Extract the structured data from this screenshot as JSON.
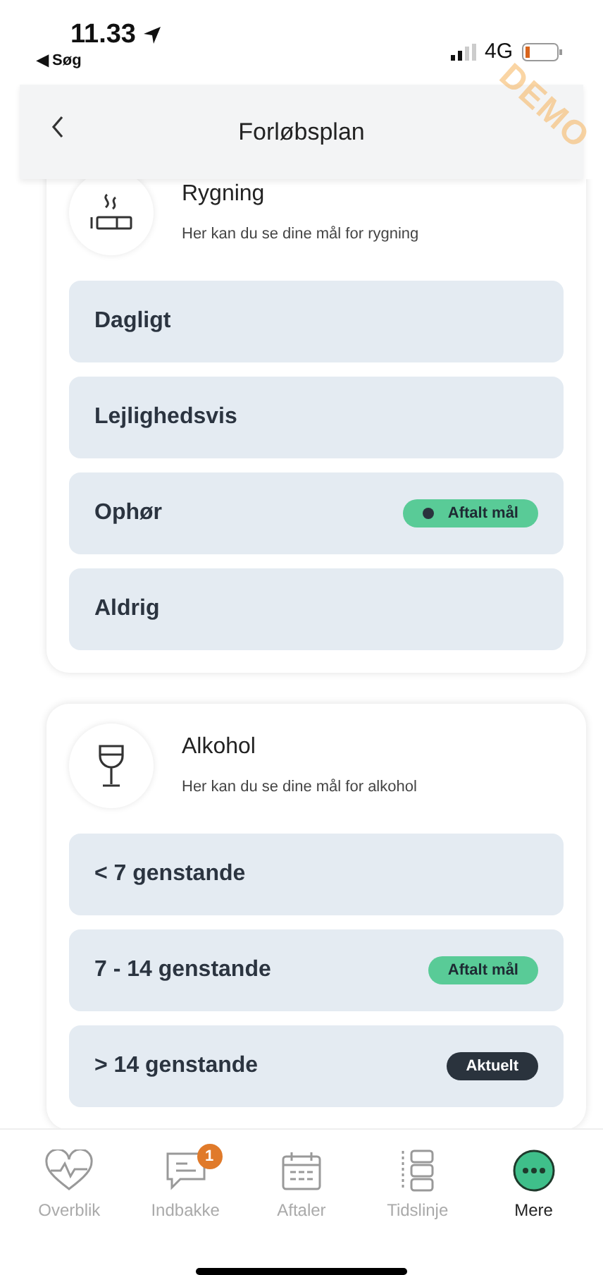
{
  "status_bar": {
    "time": "11.33",
    "back_app": "◀ Søg",
    "network": "4G"
  },
  "header": {
    "title": "Forløbsplan"
  },
  "demo_label": "DEMO",
  "cards": [
    {
      "title": "Rygning",
      "subtitle": "Her kan du se dine mål for rygning",
      "options": [
        {
          "label": "Dagligt"
        },
        {
          "label": "Lejlighedsvis"
        },
        {
          "label": "Ophør",
          "badge": {
            "kind": "agreed",
            "text": "Aftalt mål",
            "dot": true
          }
        },
        {
          "label": "Aldrig"
        }
      ]
    },
    {
      "title": "Alkohol",
      "subtitle": "Her kan du se dine mål for alkohol",
      "options": [
        {
          "label": "< 7 genstande"
        },
        {
          "label": "7 - 14 genstande",
          "badge": {
            "kind": "agreed",
            "text": "Aftalt mål",
            "dot": false
          }
        },
        {
          "label": "> 14 genstande",
          "badge": {
            "kind": "current",
            "text": "Aktuelt",
            "dot": false
          }
        }
      ]
    }
  ],
  "tab_bar": [
    {
      "label": "Overblik",
      "selected": false
    },
    {
      "label": "Indbakke",
      "selected": false,
      "count": "1"
    },
    {
      "label": "Aftaler",
      "selected": false
    },
    {
      "label": "Tidslinje",
      "selected": false
    },
    {
      "label": "Mere",
      "selected": true
    }
  ]
}
